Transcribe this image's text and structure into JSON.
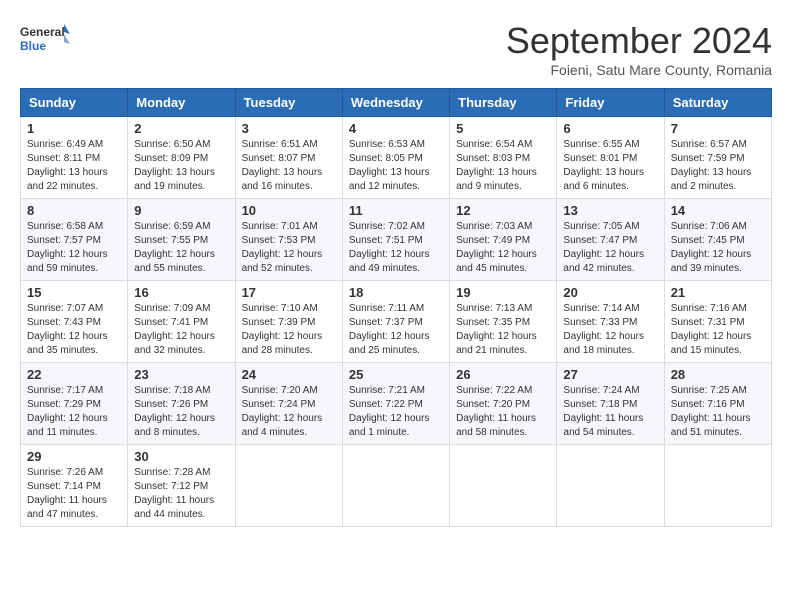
{
  "logo": {
    "text_general": "General",
    "text_blue": "Blue"
  },
  "header": {
    "title": "September 2024",
    "subtitle": "Foieni, Satu Mare County, Romania"
  },
  "weekdays": [
    "Sunday",
    "Monday",
    "Tuesday",
    "Wednesday",
    "Thursday",
    "Friday",
    "Saturday"
  ],
  "weeks": [
    [
      {
        "day": "1",
        "sunrise": "6:49 AM",
        "sunset": "8:11 PM",
        "daylight": "13 hours and 22 minutes."
      },
      {
        "day": "2",
        "sunrise": "6:50 AM",
        "sunset": "8:09 PM",
        "daylight": "13 hours and 19 minutes."
      },
      {
        "day": "3",
        "sunrise": "6:51 AM",
        "sunset": "8:07 PM",
        "daylight": "13 hours and 16 minutes."
      },
      {
        "day": "4",
        "sunrise": "6:53 AM",
        "sunset": "8:05 PM",
        "daylight": "13 hours and 12 minutes."
      },
      {
        "day": "5",
        "sunrise": "6:54 AM",
        "sunset": "8:03 PM",
        "daylight": "13 hours and 9 minutes."
      },
      {
        "day": "6",
        "sunrise": "6:55 AM",
        "sunset": "8:01 PM",
        "daylight": "13 hours and 6 minutes."
      },
      {
        "day": "7",
        "sunrise": "6:57 AM",
        "sunset": "7:59 PM",
        "daylight": "13 hours and 2 minutes."
      }
    ],
    [
      {
        "day": "8",
        "sunrise": "6:58 AM",
        "sunset": "7:57 PM",
        "daylight": "12 hours and 59 minutes."
      },
      {
        "day": "9",
        "sunrise": "6:59 AM",
        "sunset": "7:55 PM",
        "daylight": "12 hours and 55 minutes."
      },
      {
        "day": "10",
        "sunrise": "7:01 AM",
        "sunset": "7:53 PM",
        "daylight": "12 hours and 52 minutes."
      },
      {
        "day": "11",
        "sunrise": "7:02 AM",
        "sunset": "7:51 PM",
        "daylight": "12 hours and 49 minutes."
      },
      {
        "day": "12",
        "sunrise": "7:03 AM",
        "sunset": "7:49 PM",
        "daylight": "12 hours and 45 minutes."
      },
      {
        "day": "13",
        "sunrise": "7:05 AM",
        "sunset": "7:47 PM",
        "daylight": "12 hours and 42 minutes."
      },
      {
        "day": "14",
        "sunrise": "7:06 AM",
        "sunset": "7:45 PM",
        "daylight": "12 hours and 39 minutes."
      }
    ],
    [
      {
        "day": "15",
        "sunrise": "7:07 AM",
        "sunset": "7:43 PM",
        "daylight": "12 hours and 35 minutes."
      },
      {
        "day": "16",
        "sunrise": "7:09 AM",
        "sunset": "7:41 PM",
        "daylight": "12 hours and 32 minutes."
      },
      {
        "day": "17",
        "sunrise": "7:10 AM",
        "sunset": "7:39 PM",
        "daylight": "12 hours and 28 minutes."
      },
      {
        "day": "18",
        "sunrise": "7:11 AM",
        "sunset": "7:37 PM",
        "daylight": "12 hours and 25 minutes."
      },
      {
        "day": "19",
        "sunrise": "7:13 AM",
        "sunset": "7:35 PM",
        "daylight": "12 hours and 21 minutes."
      },
      {
        "day": "20",
        "sunrise": "7:14 AM",
        "sunset": "7:33 PM",
        "daylight": "12 hours and 18 minutes."
      },
      {
        "day": "21",
        "sunrise": "7:16 AM",
        "sunset": "7:31 PM",
        "daylight": "12 hours and 15 minutes."
      }
    ],
    [
      {
        "day": "22",
        "sunrise": "7:17 AM",
        "sunset": "7:29 PM",
        "daylight": "12 hours and 11 minutes."
      },
      {
        "day": "23",
        "sunrise": "7:18 AM",
        "sunset": "7:26 PM",
        "daylight": "12 hours and 8 minutes."
      },
      {
        "day": "24",
        "sunrise": "7:20 AM",
        "sunset": "7:24 PM",
        "daylight": "12 hours and 4 minutes."
      },
      {
        "day": "25",
        "sunrise": "7:21 AM",
        "sunset": "7:22 PM",
        "daylight": "12 hours and 1 minute."
      },
      {
        "day": "26",
        "sunrise": "7:22 AM",
        "sunset": "7:20 PM",
        "daylight": "11 hours and 58 minutes."
      },
      {
        "day": "27",
        "sunrise": "7:24 AM",
        "sunset": "7:18 PM",
        "daylight": "11 hours and 54 minutes."
      },
      {
        "day": "28",
        "sunrise": "7:25 AM",
        "sunset": "7:16 PM",
        "daylight": "11 hours and 51 minutes."
      }
    ],
    [
      {
        "day": "29",
        "sunrise": "7:26 AM",
        "sunset": "7:14 PM",
        "daylight": "11 hours and 47 minutes."
      },
      {
        "day": "30",
        "sunrise": "7:28 AM",
        "sunset": "7:12 PM",
        "daylight": "11 hours and 44 minutes."
      },
      null,
      null,
      null,
      null,
      null
    ]
  ]
}
